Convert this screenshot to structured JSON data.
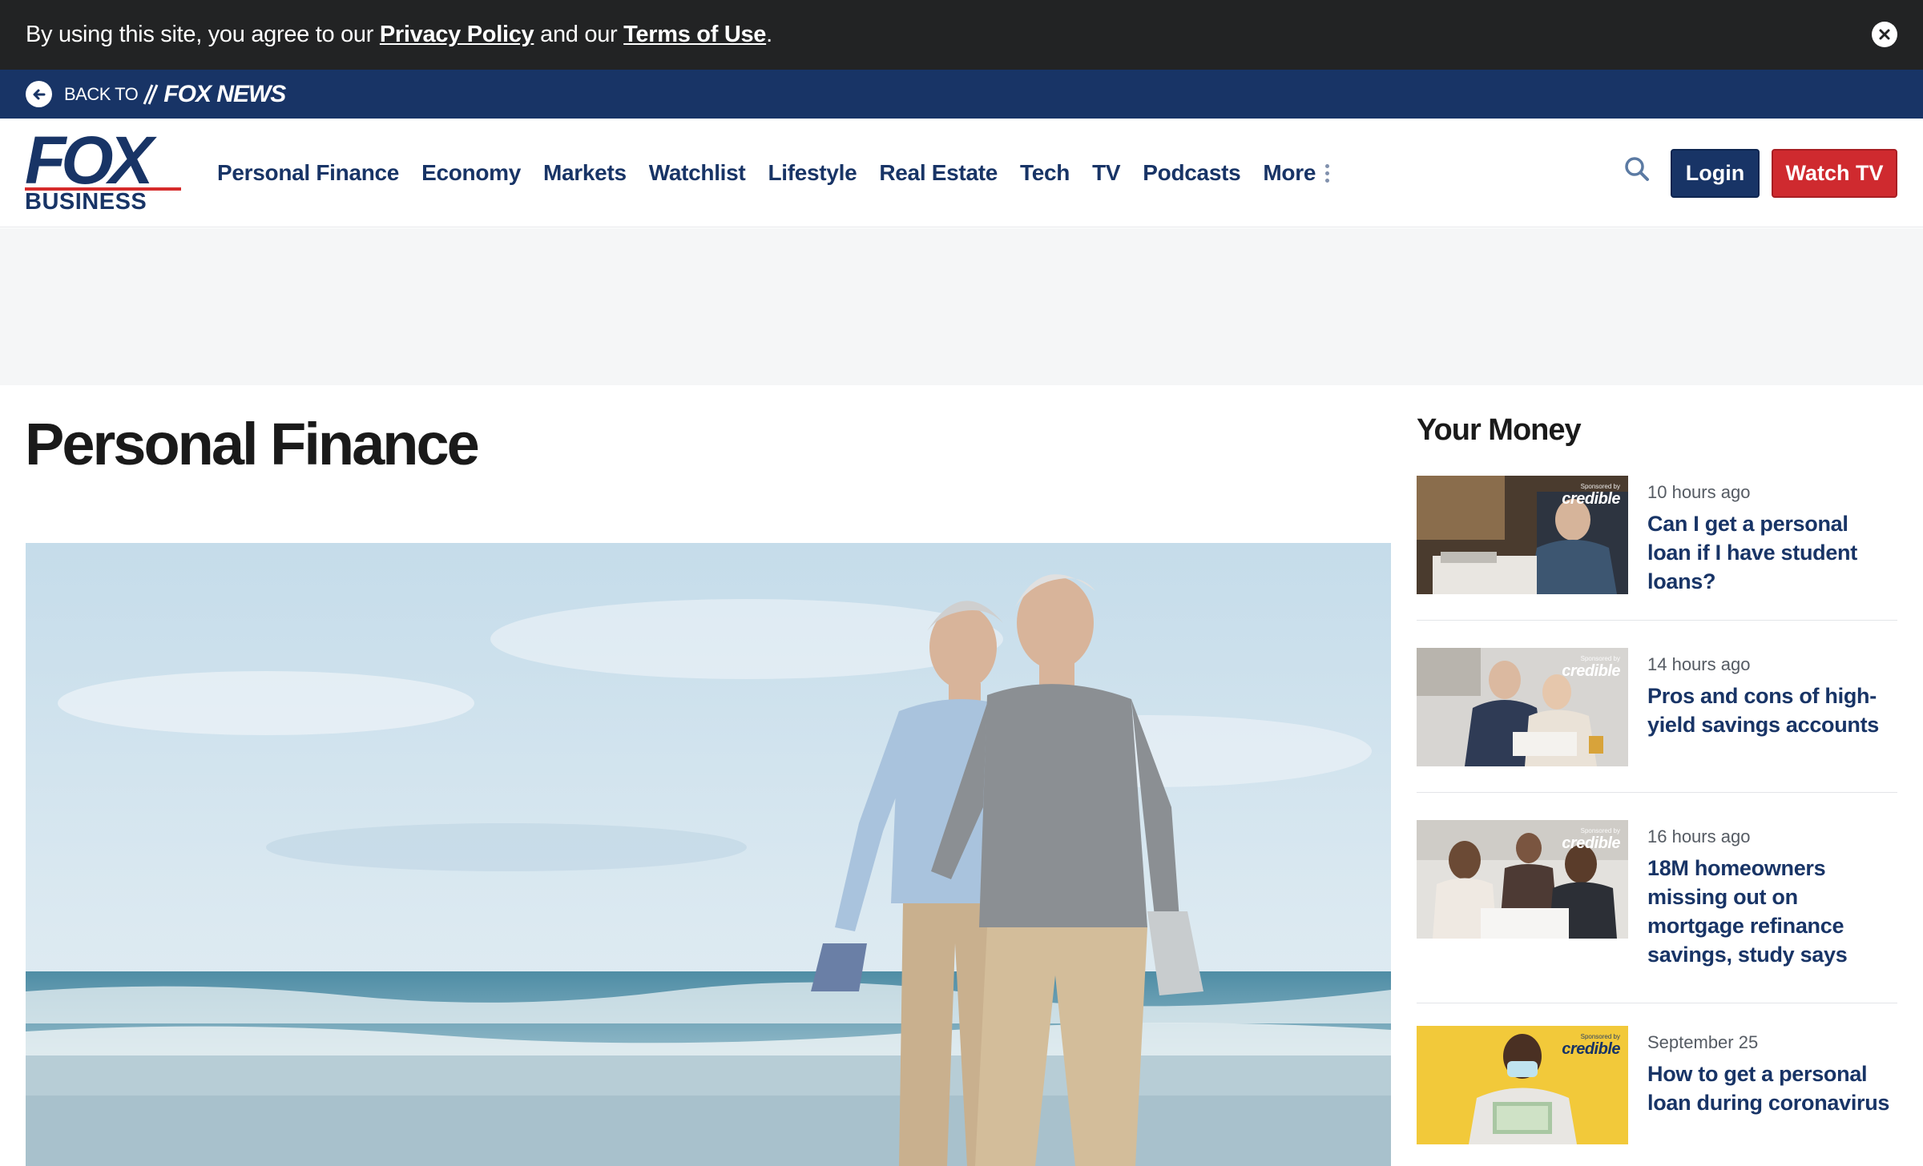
{
  "consent": {
    "text_before": "By using this site, you agree to our ",
    "privacy_link": "Privacy Policy",
    "text_middle": " and our ",
    "terms_link": "Terms of Use",
    "text_after": "."
  },
  "backbar": {
    "label": "BACK TO",
    "brand": "FOX NEWS"
  },
  "logo": {
    "top": "FOX",
    "bottom": "BUSINESS"
  },
  "nav": {
    "items": [
      "Personal Finance",
      "Economy",
      "Markets",
      "Watchlist",
      "Lifestyle",
      "Real Estate",
      "Tech",
      "TV",
      "Podcasts"
    ],
    "more_label": "More"
  },
  "header_actions": {
    "login_label": "Login",
    "watch_label": "Watch TV"
  },
  "page": {
    "title": "Personal Finance"
  },
  "sidebar": {
    "title": "Your Money",
    "sponsor_small": "Sponsored by",
    "sponsor_name": "credible",
    "stories": [
      {
        "time": "10 hours ago",
        "headline": "Can I get a personal loan if I have student loans?"
      },
      {
        "time": "14 hours ago",
        "headline": "Pros and cons of high-yield savings accounts"
      },
      {
        "time": "16 hours ago",
        "headline": "18M homeowners missing out on mortgage refinance savings, study says"
      },
      {
        "time": "September 25",
        "headline": "How to get a personal loan during coronavirus"
      }
    ]
  },
  "colors": {
    "navy": "#183466",
    "red": "#cf2a2f",
    "consent_bg": "#222324"
  }
}
